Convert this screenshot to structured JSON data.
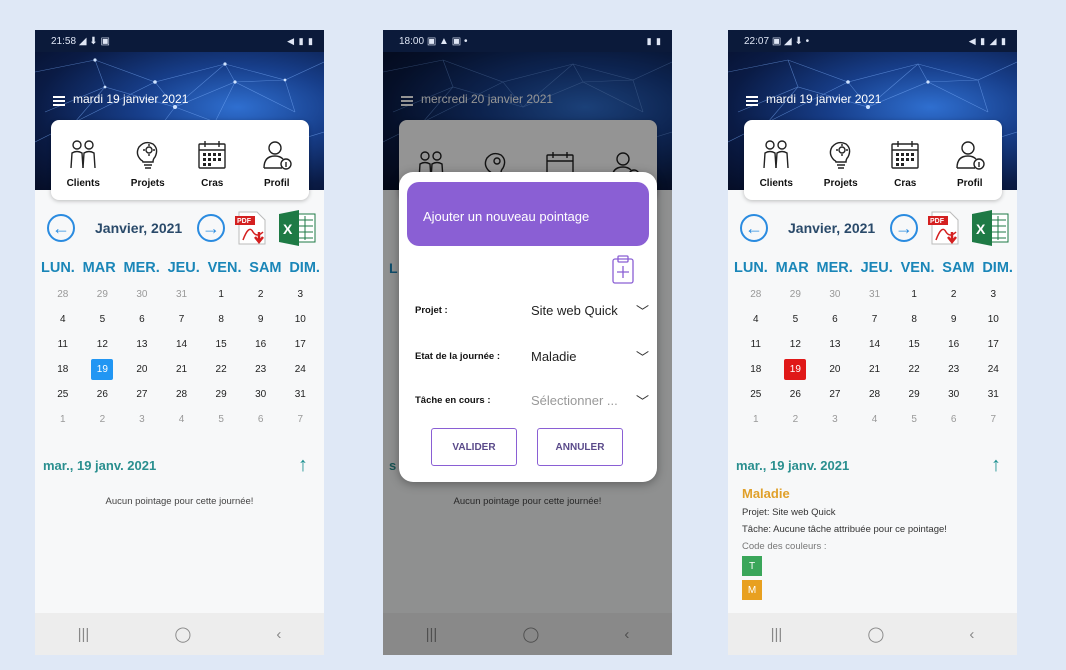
{
  "icons_note_none": "",
  "phones": [
    {
      "status": {
        "time": "21:58",
        "left_icons": "◢ ⬇ ▣",
        "right_icons": "◀ ▮ ▮"
      },
      "header_date": "mardi 19 janvier 2021",
      "nav": {
        "clients": "Clients",
        "projets": "Projets",
        "cras": "Cras",
        "profil": "Profil"
      },
      "month_label": "Janvier, 2021",
      "weekdays": [
        "LUN.",
        "MAR",
        "MER.",
        "JEU.",
        "VEN.",
        "SAM",
        "DIM."
      ],
      "selected_color": "#2196f3",
      "weeks": [
        [
          [
            "28",
            1
          ],
          [
            "29",
            1
          ],
          [
            "30",
            1
          ],
          [
            "31",
            1
          ],
          [
            "1",
            0
          ],
          [
            "2",
            0
          ],
          [
            "3",
            0
          ]
        ],
        [
          [
            "4",
            0
          ],
          [
            "5",
            0
          ],
          [
            "6",
            0
          ],
          [
            "7",
            0
          ],
          [
            "8",
            0
          ],
          [
            "9",
            0
          ],
          [
            "10",
            0
          ]
        ],
        [
          [
            "11",
            0
          ],
          [
            "12",
            0
          ],
          [
            "13",
            0
          ],
          [
            "14",
            0
          ],
          [
            "15",
            0
          ],
          [
            "16",
            0
          ],
          [
            "17",
            0
          ]
        ],
        [
          [
            "18",
            0
          ],
          [
            "19",
            2
          ],
          [
            "20",
            0
          ],
          [
            "21",
            0
          ],
          [
            "22",
            0
          ],
          [
            "23",
            0
          ],
          [
            "24",
            0
          ]
        ],
        [
          [
            "25",
            0
          ],
          [
            "26",
            0
          ],
          [
            "27",
            0
          ],
          [
            "28",
            0
          ],
          [
            "29",
            0
          ],
          [
            "30",
            0
          ],
          [
            "31",
            0
          ]
        ],
        [
          [
            "1",
            1
          ],
          [
            "2",
            1
          ],
          [
            "3",
            1
          ],
          [
            "4",
            1
          ],
          [
            "5",
            1
          ],
          [
            "6",
            1
          ],
          [
            "7",
            1
          ]
        ]
      ],
      "day_label": "mar., 19 janv. 2021",
      "empty_message": "Aucun pointage pour cette journée!",
      "navbar": {
        "recent": "|||",
        "home": "◯",
        "back": "‹"
      }
    },
    {
      "status": {
        "time": "18:00",
        "left_icons": "▣ ▲ ▣ •",
        "right_icons": "▮ ▮"
      },
      "header_date": "mercredi 20 janvier 2021",
      "nav": {
        "clients": "",
        "projets": "",
        "cras": "",
        "profil": ""
      },
      "dialog": {
        "title": "Ajouter un nouveau pointage",
        "projet_label": "Projet :",
        "projet_value": "Site web Quick",
        "etat_label": "Etat de la journée :",
        "etat_value": "Maladie",
        "tache_label": "Tâche en cours :",
        "tache_placeholder": "Sélectionner ...",
        "valider": "VALIDER",
        "annuler": "ANNULER"
      },
      "partial_day_label": "s",
      "partial_weekday": "L",
      "empty_message": "Aucun pointage pour cette journée!",
      "navbar": {
        "recent": "|||",
        "home": "◯",
        "back": "‹"
      }
    },
    {
      "status": {
        "time": "22:07",
        "left_icons": "▣ ◢ ⬇ •",
        "right_icons": "◀ ▮ ◢ ▮"
      },
      "header_date": "mardi 19 janvier 2021",
      "nav": {
        "clients": "Clients",
        "projets": "Projets",
        "cras": "Cras",
        "profil": "Profil"
      },
      "month_label": "Janvier, 2021",
      "weekdays": [
        "LUN.",
        "MAR",
        "MER.",
        "JEU.",
        "VEN.",
        "SAM",
        "DIM."
      ],
      "selected_color": "#e01818",
      "weeks": [
        [
          [
            "28",
            1
          ],
          [
            "29",
            1
          ],
          [
            "30",
            1
          ],
          [
            "31",
            1
          ],
          [
            "1",
            0
          ],
          [
            "2",
            0
          ],
          [
            "3",
            0
          ]
        ],
        [
          [
            "4",
            0
          ],
          [
            "5",
            0
          ],
          [
            "6",
            0
          ],
          [
            "7",
            0
          ],
          [
            "8",
            0
          ],
          [
            "9",
            0
          ],
          [
            "10",
            0
          ]
        ],
        [
          [
            "11",
            0
          ],
          [
            "12",
            0
          ],
          [
            "13",
            0
          ],
          [
            "14",
            0
          ],
          [
            "15",
            0
          ],
          [
            "16",
            0
          ],
          [
            "17",
            0
          ]
        ],
        [
          [
            "18",
            0
          ],
          [
            "19",
            2
          ],
          [
            "20",
            0
          ],
          [
            "21",
            0
          ],
          [
            "22",
            0
          ],
          [
            "23",
            0
          ],
          [
            "24",
            0
          ]
        ],
        [
          [
            "25",
            0
          ],
          [
            "26",
            0
          ],
          [
            "27",
            0
          ],
          [
            "28",
            0
          ],
          [
            "29",
            0
          ],
          [
            "30",
            0
          ],
          [
            "31",
            0
          ]
        ],
        [
          [
            "1",
            1
          ],
          [
            "2",
            1
          ],
          [
            "3",
            1
          ],
          [
            "4",
            1
          ],
          [
            "5",
            1
          ],
          [
            "6",
            1
          ],
          [
            "7",
            1
          ]
        ]
      ],
      "day_label": "mar., 19 janv. 2021",
      "entry": {
        "category": "Maladie",
        "projet_line": "Projet: Site web Quick",
        "tache_line": "Tâche: Aucune tâche attribuée pour ce pointage!",
        "legend_title": "Code des couleurs :",
        "legend": [
          {
            "code": "T",
            "color": "#3aa65a"
          },
          {
            "code": "M",
            "color": "#e8a020"
          }
        ]
      },
      "navbar": {
        "recent": "|||",
        "home": "◯",
        "back": "‹"
      }
    }
  ]
}
